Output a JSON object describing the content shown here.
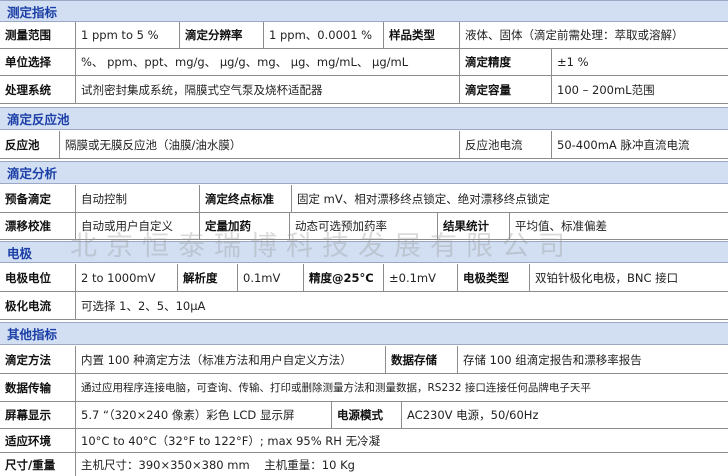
{
  "sections": {
    "s1": "测定指标",
    "s2": "滴定反应池",
    "s3": "滴定分析",
    "s4": "电极",
    "s5": "其他指标"
  },
  "r1": {
    "k1": "测量范围",
    "v1": "1 ppm to 5 %",
    "k2": "滴定分辨率",
    "v2": "1 ppm、0.0001 %",
    "k3": "样品类型",
    "v3": "液体、固体（滴定前需处理：萃取或溶解）"
  },
  "r2": {
    "k1": "单位选择",
    "v1": "%、 ppm、ppt、mg/g、 μg/g、mg、 μg、mg/mL、 μg/mL",
    "k2": "滴定精度",
    "v2": "±1 %"
  },
  "r3": {
    "k1": "处理系统",
    "v1": "试剂密封集成系统，隔膜式空气泵及烧杯适配器",
    "k2": "滴定容量",
    "v2": "100 – 200mL范围"
  },
  "r4": {
    "k1": "反应池",
    "v1": "隔膜或无膜反应池（油膜/油水膜）",
    "k2": "反应池电流",
    "v2": "50-400mA 脉冲直流电流"
  },
  "r5": {
    "k1": "预备滴定",
    "v1": "自动控制",
    "k2": "滴定终点标准",
    "v2": "固定 mV、相对漂移终点锁定、绝对漂移终点锁定"
  },
  "r6": {
    "k1": "漂移校准",
    "v1": "自动或用户自定义",
    "k2": "定量加药",
    "v2": "动态可选预加药率",
    "k3": "结果统计",
    "v3": "平均值、标准偏差"
  },
  "r7": {
    "k1": "电极电位",
    "v1": "2 to 1000mV",
    "k2": "解析度",
    "v2": "0.1mV",
    "k3": "精度@25°C",
    "v3": "±0.1mV",
    "k4": "电极类型",
    "v4": "双铂针极化电极，BNC 接口"
  },
  "r8": {
    "k1": "极化电流",
    "v1": "可选择 1、2、5、10μA"
  },
  "r9": {
    "k1": "滴定方法",
    "v1": "内置 100 种滴定方法（标准方法和用户自定义方法）",
    "k2": "数据存储",
    "v2": "存储 100 组滴定报告和漂移率报告"
  },
  "r10": {
    "k1": "数据传输",
    "v1": "通过应用程序连接电脑，可查询、传输、打印或删除测量方法和测量数据，RS232 接口连接任何品牌电子天平"
  },
  "r11": {
    "k1": "屏幕显示",
    "v1": "5.7 “（320×240 像素）彩色 LCD 显示屏",
    "k2": "电源模式",
    "v2": "AC230V 电源，50/60Hz"
  },
  "r12": {
    "k1": "适应环境",
    "v1": "10°C to 40°C（32°F to 122°F）; max 95% RH 无冷凝"
  },
  "r13": {
    "k1": "尺寸/重量",
    "v1": "主机尺寸：390×350×380 mm    主机重量：10 Kg"
  },
  "watermark": "北京恒泰瑞博科技发展有限公司",
  "colors": {
    "band_bg": "#d2dff3",
    "band_text": "#1b3fa6",
    "grid": "#8c8c8c"
  }
}
